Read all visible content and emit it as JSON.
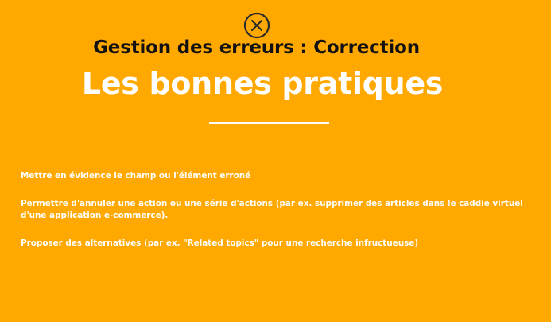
{
  "colors": {
    "background": "#FFA800",
    "subtitle": "#111111",
    "title": "#FFFFFF",
    "divider": "#FFFFFF",
    "body_text": "#FFFFFF",
    "icon": "#2A2A2A"
  },
  "header": {
    "icon": "close-circle-icon",
    "subtitle": "Gestion des erreurs : Correction",
    "title": "Les bonnes pratiques"
  },
  "bullets": [
    "Mettre en évidence le champ ou l'élément erroné",
    "Permettre d'annuler une action ou une série d'actions (par ex. supprimer des articles dans le caddie virtuel d'une application e-commerce).",
    "Proposer des alternatives (par ex. \"Related topics\" pour une recherche infructueuse)"
  ]
}
